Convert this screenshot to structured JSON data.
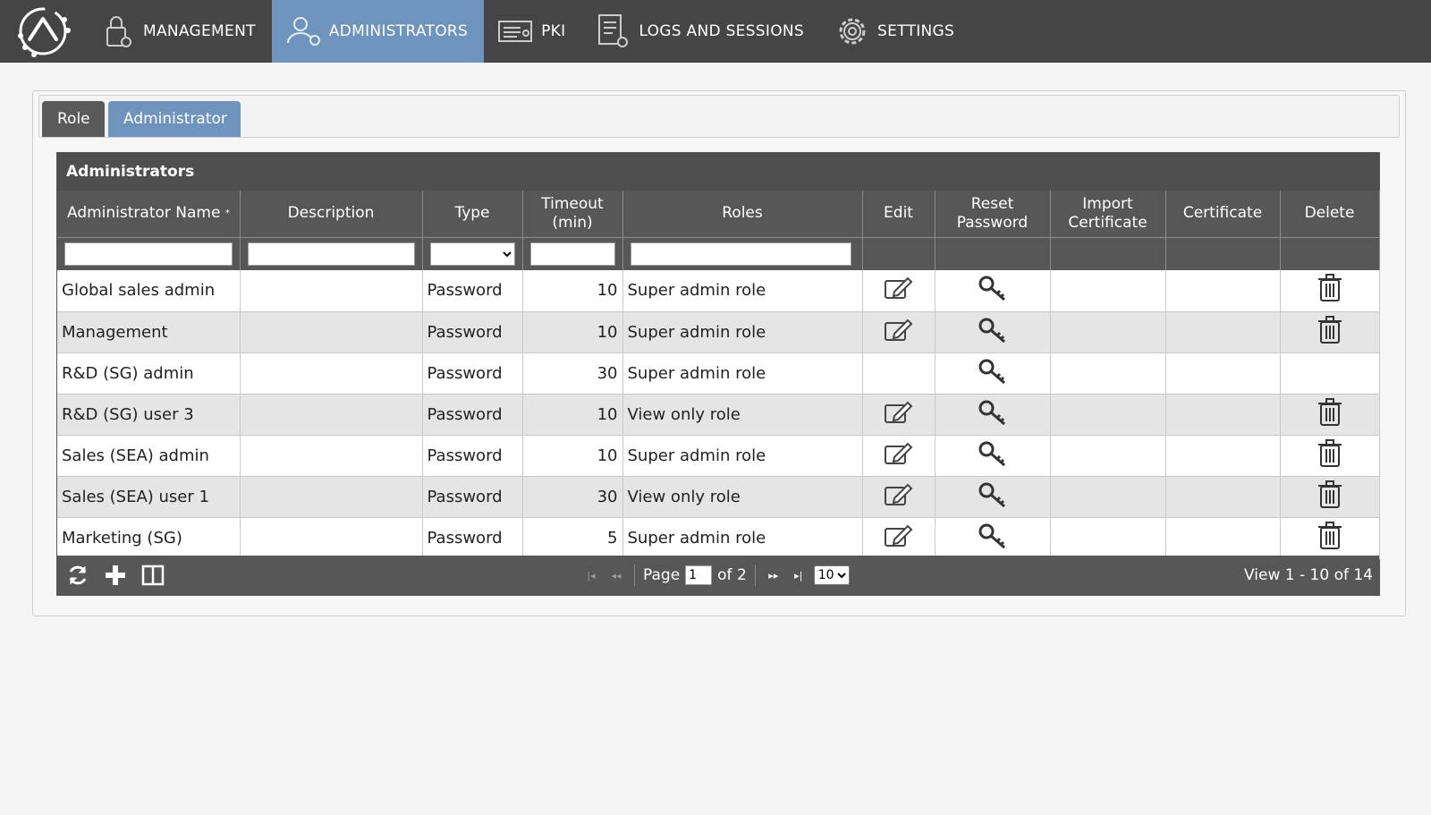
{
  "nav": {
    "items": [
      {
        "label": "MANAGEMENT",
        "icon": "lock-gear-icon"
      },
      {
        "label": "ADMINISTRATORS",
        "icon": "user-gear-icon"
      },
      {
        "label": "PKI",
        "icon": "certificate-icon"
      },
      {
        "label": "LOGS AND SESSIONS",
        "icon": "document-gear-icon"
      },
      {
        "label": "SETTINGS",
        "icon": "gear-icon"
      }
    ],
    "active": "ADMINISTRATORS"
  },
  "tabs": {
    "role": "Role",
    "administrator": "Administrator",
    "active": "Administrator"
  },
  "grid": {
    "caption": "Administrators",
    "columns": {
      "name": "Administrator Name",
      "description": "Description",
      "type": "Type",
      "timeout_line1": "Timeout",
      "timeout_line2": "(min)",
      "roles": "Roles",
      "edit": "Edit",
      "reset_line1": "Reset",
      "reset_line2": "Password",
      "import_line1": "Import",
      "import_line2": "Certificate",
      "certificate": "Certificate",
      "delete": "Delete"
    },
    "rows": [
      {
        "name": "Global sales admin",
        "description": "",
        "type": "Password",
        "timeout": "10",
        "roles": "Super admin role",
        "editable": true,
        "deletable": true
      },
      {
        "name": "Management",
        "description": "",
        "type": "Password",
        "timeout": "10",
        "roles": "Super admin role",
        "editable": true,
        "deletable": true
      },
      {
        "name": "R&D (SG) admin",
        "description": "",
        "type": "Password",
        "timeout": "30",
        "roles": "Super admin role",
        "editable": false,
        "deletable": false
      },
      {
        "name": "R&D (SG) user 3",
        "description": "",
        "type": "Password",
        "timeout": "10",
        "roles": "View only role",
        "editable": true,
        "deletable": true
      },
      {
        "name": "Sales (SEA) admin",
        "description": "",
        "type": "Password",
        "timeout": "10",
        "roles": "Super admin role",
        "editable": true,
        "deletable": true
      },
      {
        "name": "Sales (SEA) user 1",
        "description": "",
        "type": "Password",
        "timeout": "30",
        "roles": "View only role",
        "editable": true,
        "deletable": true
      },
      {
        "name": "Marketing (SG)",
        "description": "",
        "type": "Password",
        "timeout": "5",
        "roles": "Super admin role",
        "editable": true,
        "deletable": true
      }
    ]
  },
  "pager": {
    "page_label": "Page",
    "page_value": "1",
    "of_label": "of 2",
    "page_size": "10",
    "view_text": "View 1 - 10 of 14"
  },
  "colors": {
    "topbar": "#454545",
    "accent": "#6e93bd",
    "grid_header": "#575757"
  }
}
